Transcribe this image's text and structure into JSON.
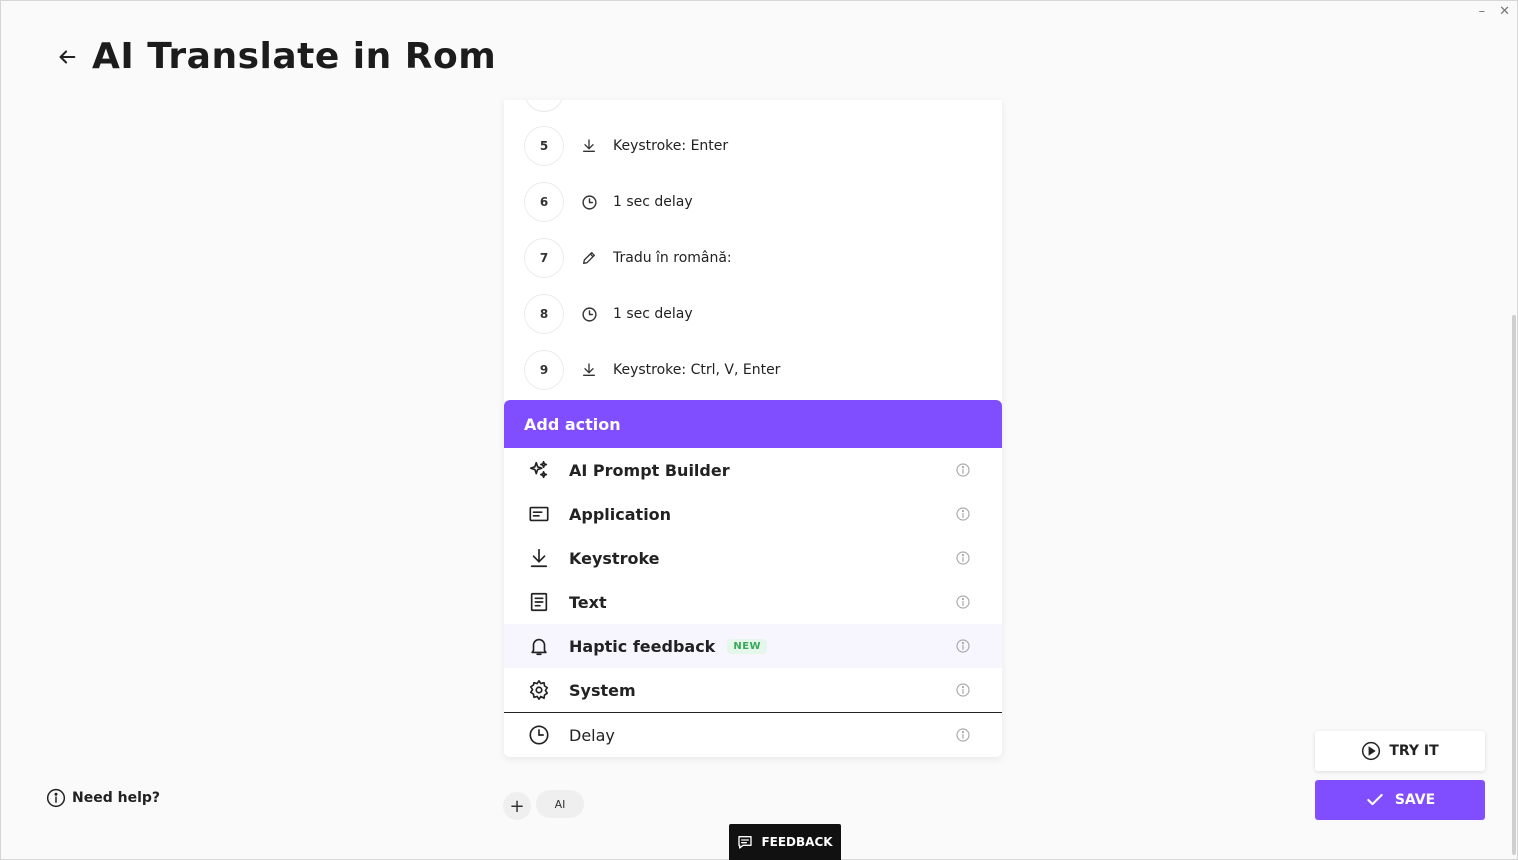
{
  "window": {
    "minimize": "–",
    "close": "✕"
  },
  "header": {
    "title": "AI Translate in Rom",
    "back_icon": "arrow-left-icon"
  },
  "steps": [
    {
      "number": "5",
      "icon": "download-icon",
      "label": "Keystroke: Enter"
    },
    {
      "number": "6",
      "icon": "clock-icon",
      "label": "1 sec delay"
    },
    {
      "number": "7",
      "icon": "pencil-icon",
      "label": "Tradu în română:"
    },
    {
      "number": "8",
      "icon": "clock-icon",
      "label": "1 sec delay"
    },
    {
      "number": "9",
      "icon": "download-icon",
      "label": "Keystroke: Ctrl, V, Enter"
    }
  ],
  "add_action": {
    "title": "Add action",
    "items": [
      {
        "label": "AI Prompt Builder",
        "icon": "sparkle-icon"
      },
      {
        "label": "Application",
        "icon": "application-icon"
      },
      {
        "label": "Keystroke",
        "icon": "download-icon"
      },
      {
        "label": "Text",
        "icon": "document-icon"
      },
      {
        "label": "Haptic feedback",
        "icon": "bell-icon",
        "badge": "NEW"
      },
      {
        "label": "System",
        "icon": "gear-icon"
      },
      {
        "label": "Delay",
        "icon": "clock-icon"
      }
    ]
  },
  "bottom": {
    "add": "+",
    "ai": "AI"
  },
  "help": {
    "label": "Need help?"
  },
  "feedback": {
    "label": "FEEDBACK"
  },
  "buttons": {
    "try_it": "TRY IT",
    "save": "SAVE"
  },
  "colors": {
    "accent": "#814eff",
    "new_badge": "#38a85a"
  }
}
